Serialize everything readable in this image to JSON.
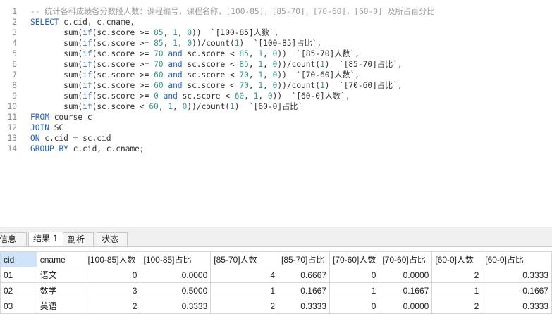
{
  "editor": {
    "lines": [
      {
        "n": "1",
        "html": "<span class=\"cm\">-- 统计各科成绩各分数段人数：课程编号，课程名称，[100-85]，[85-70]，[70-60]，[60-0] 及所占百分比</span>"
      },
      {
        "n": "2",
        "html": "<span class=\"kw\">SELECT</span> c.cid, c.cname,"
      },
      {
        "n": "3",
        "html": "       sum(<span class=\"fn\">if</span>(sc.score &gt;= <span class=\"nm\">85</span>, <span class=\"nm\">1</span>, <span class=\"nm\">0</span>))  `[100-85]人数`,"
      },
      {
        "n": "4",
        "html": "       sum(<span class=\"fn\">if</span>(sc.score &gt;= <span class=\"nm\">85</span>, <span class=\"nm\">1</span>, <span class=\"nm\">0</span>))/count(<span class=\"nm\">1</span>)  `[100-85]占比`,"
      },
      {
        "n": "5",
        "html": "       sum(<span class=\"fn\">if</span>(sc.score &gt;= <span class=\"nm\">70</span> <span class=\"kw\">and</span> sc.score &lt; <span class=\"nm\">85</span>, <span class=\"nm\">1</span>, <span class=\"nm\">0</span>))  `[85-70]人数`,"
      },
      {
        "n": "6",
        "html": "       sum(<span class=\"fn\">if</span>(sc.score &gt;= <span class=\"nm\">70</span> <span class=\"kw\">and</span> sc.score &lt; <span class=\"nm\">85</span>, <span class=\"nm\">1</span>, <span class=\"nm\">0</span>))/count(<span class=\"nm\">1</span>)  `[85-70]占比`,"
      },
      {
        "n": "7",
        "html": "       sum(<span class=\"fn\">if</span>(sc.score &gt;= <span class=\"nm\">60</span> <span class=\"kw\">and</span> sc.score &lt; <span class=\"nm\">70</span>, <span class=\"nm\">1</span>, <span class=\"nm\">0</span>))  `[70-60]人数`,"
      },
      {
        "n": "8",
        "html": "       sum(<span class=\"fn\">if</span>(sc.score &gt;= <span class=\"nm\">60</span> <span class=\"kw\">and</span> sc.score &lt; <span class=\"nm\">70</span>, <span class=\"nm\">1</span>, <span class=\"nm\">0</span>))/count(<span class=\"nm\">1</span>)  `[70-60]占比`,"
      },
      {
        "n": "9",
        "html": "       sum(<span class=\"fn\">if</span>(sc.score &gt;= <span class=\"nm\">0</span> <span class=\"kw\">and</span> sc.score &lt; <span class=\"nm\">60</span>, <span class=\"nm\">1</span>, <span class=\"nm\">0</span>))  `[60-0]人数`,"
      },
      {
        "n": "10",
        "html": "       sum(<span class=\"fn\">if</span>(sc.score &lt; <span class=\"nm\">60</span>, <span class=\"nm\">1</span>, <span class=\"nm\">0</span>))/count(<span class=\"nm\">1</span>)  `[60-0]占比`"
      },
      {
        "n": "11",
        "html": "<span class=\"kw\">FROM</span> course c"
      },
      {
        "n": "12",
        "html": "<span class=\"kw\">JOIN</span> SC"
      },
      {
        "n": "13",
        "html": "<span class=\"kw\">ON</span> c.cid = sc.cid"
      },
      {
        "n": "14",
        "html": "<span class=\"kw\">GROUP BY</span> c.cid, c.cname;"
      }
    ]
  },
  "tabs": [
    {
      "label": "信息"
    },
    {
      "label": "结果 1"
    },
    {
      "label": "剖析"
    },
    {
      "label": "状态"
    }
  ],
  "grid": {
    "columns": [
      "cid",
      "cname",
      "[100-85]人数",
      "[100-85]占比",
      "[85-70]人数",
      "[85-70]占比",
      "[70-60]人数",
      "[70-60]占比",
      "[60-0]人数",
      "[60-0]占比"
    ],
    "rows": [
      [
        "01",
        "语文",
        "0",
        "0.0000",
        "4",
        "0.6667",
        "0",
        "0.0000",
        "2",
        "0.3333"
      ],
      [
        "02",
        "数学",
        "3",
        "0.5000",
        "1",
        "0.1667",
        "1",
        "0.1667",
        "1",
        "0.1667"
      ],
      [
        "03",
        "英语",
        "2",
        "0.3333",
        "2",
        "0.3333",
        "0",
        "0.0000",
        "2",
        "0.3333"
      ]
    ]
  }
}
